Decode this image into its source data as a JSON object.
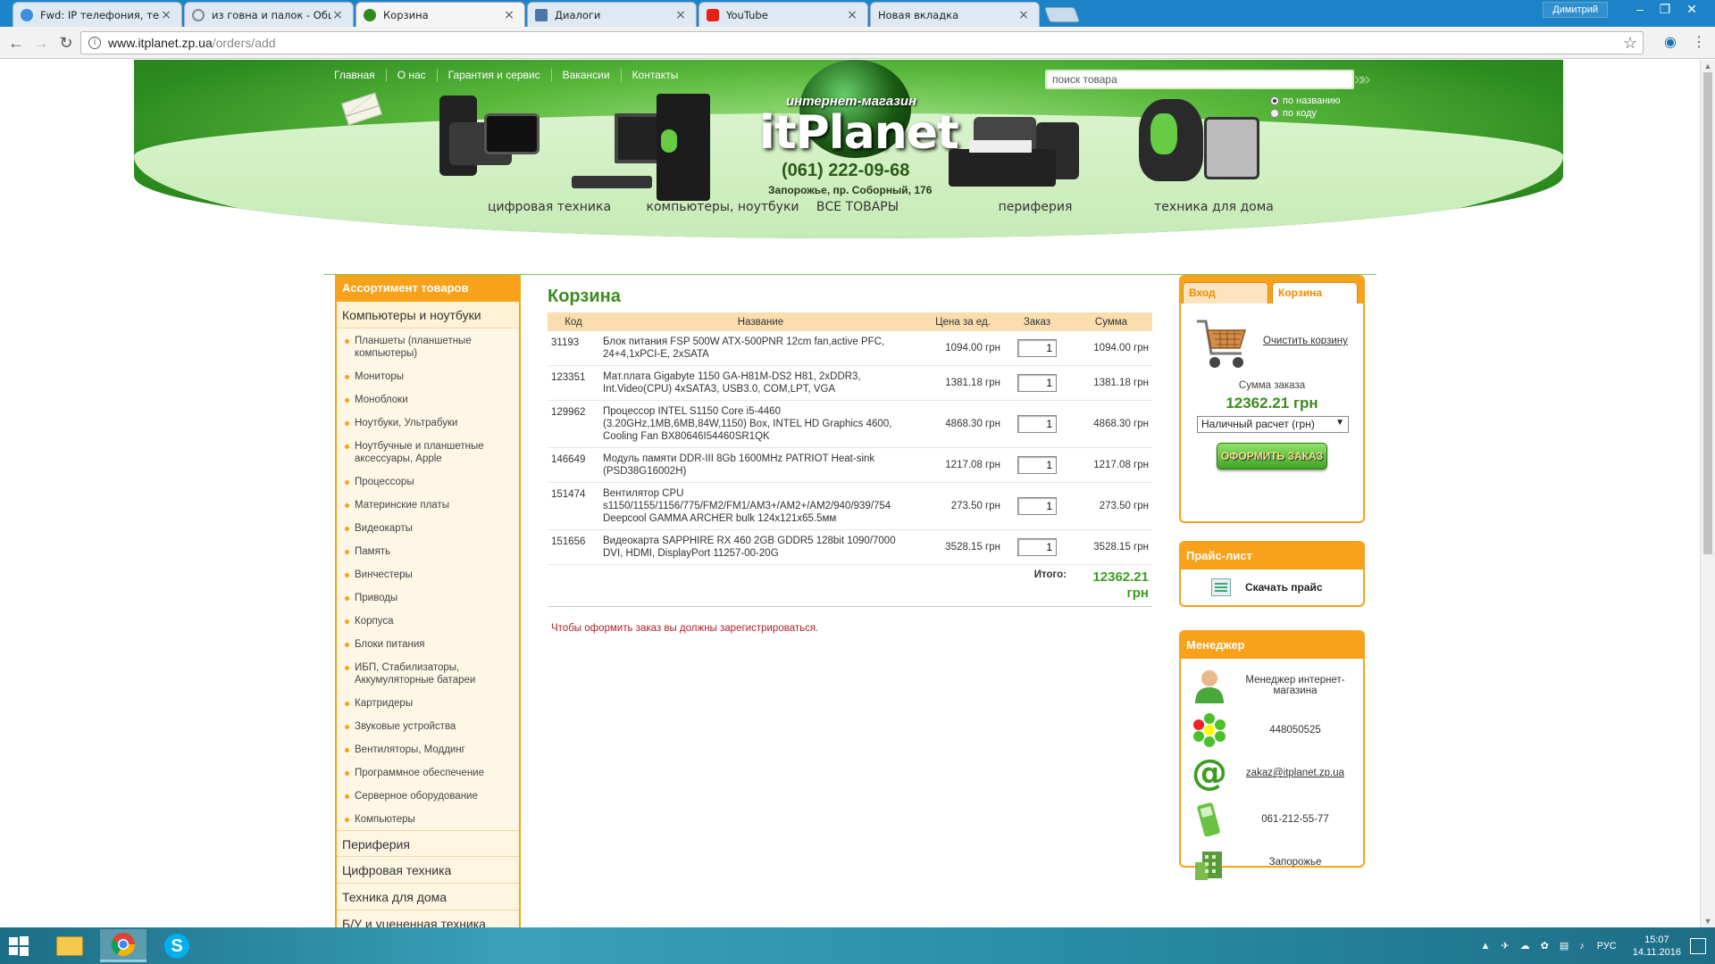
{
  "browser": {
    "tabs": [
      {
        "title": "Fwd: IP телефония, тенд",
        "color": "#3d8ee0"
      },
      {
        "title": "из говна и палок - Общ",
        "color": "#888888"
      },
      {
        "title": "Корзина",
        "color": "#2f8a1e"
      },
      {
        "title": "Диалоги",
        "color": "#4a76a8"
      },
      {
        "title": "YouTube",
        "color": "#e62117"
      },
      {
        "title": "Новая вкладка",
        "color": "#dfe9f3"
      }
    ],
    "user": "Димитрий",
    "url_domain": "www.itplanet.zp.ua",
    "url_path": "/orders/add"
  },
  "site": {
    "topnav": [
      "Главная",
      "О нас",
      "Гарантия и сервис",
      "Вакансии",
      "Контакты"
    ],
    "search_placeholder": "поиск товара",
    "search_mode": [
      "по названию",
      "по коду"
    ],
    "logo_sub": "интернет-магазин",
    "logo_main": "itPlanet",
    "phone": "(061) 222-09-68",
    "address": "Запорожье, пр. Соборный, 176",
    "categories": [
      "цифровая техника",
      "компьютеры, ноутбуки",
      "ВСЕ ТОВАРЫ",
      "периферия",
      "техника для дома"
    ]
  },
  "sidebar": {
    "title": "Ассортимент товаров",
    "open_category": "Компьютеры и ноутбуки",
    "items": [
      "Планшеты (планшетные компьютеры)",
      "Мониторы",
      "Моноблоки",
      "Ноутбуки, Ультрабуки",
      "Ноутбучные и планшетные аксессуары, Apple",
      "Процессоры",
      "Материнские платы",
      "Видеокарты",
      "Память",
      "Винчестеры",
      "Приводы",
      "Корпуса",
      "Блоки питания",
      "ИБП, Стабилизаторы, Аккумуляторные батареи",
      "Картридеры",
      "Звуковые устройства",
      "Вентиляторы, Моддинг",
      "Программное обеспечение",
      "Серверное оборудование",
      "Компьютеры"
    ],
    "other_categories": [
      "Периферия",
      "Цифровая техника",
      "Техника для дома",
      "Б/У и уцененная техника"
    ]
  },
  "cart": {
    "title": "Корзина",
    "columns": [
      "Код",
      "Название",
      "Цена за ед.",
      "Заказ",
      "Сумма"
    ],
    "rows": [
      {
        "code": "31193",
        "name": "Блок питания FSP 500W ATX-500PNR 12cm fan,active PFC, 24+4,1xPCI-E, 2xSATA",
        "price": "1094.00 грн",
        "qty": "1",
        "sum": "1094.00 грн"
      },
      {
        "code": "123351",
        "name": "Мат.плата Gigabyte 1150 GA-H81M-DS2 H81, 2xDDR3, Int.Video(CPU) 4xSATA3, USB3.0, COM,LPT, VGA",
        "price": "1381.18 грн",
        "qty": "1",
        "sum": "1381.18 грн"
      },
      {
        "code": "129962",
        "name": "Процессор INTEL S1150 Core i5-4460 (3.20GHz,1MB,6MB,84W,1150) Box, INTEL HD Graphics 4600, Cooling Fan BX80646I54460SR1QK",
        "price": "4868.30 грн",
        "qty": "1",
        "sum": "4868.30 грн"
      },
      {
        "code": "146649",
        "name": "Модуль памяти DDR-III 8Gb 1600MHz PATRIOT Heat-sink (PSD38G16002H)",
        "price": "1217.08 грн",
        "qty": "1",
        "sum": "1217.08 грн"
      },
      {
        "code": "151474",
        "name": "Вентилятор CPU s1150/1155/1156/775/FM2/FM1/AM3+/AM2+/AM2/940/939/754 Deepcool GAMMA ARCHER bulk 124x121x65.5мм",
        "price": "273.50 грн",
        "qty": "1",
        "sum": "273.50 грн"
      },
      {
        "code": "151656",
        "name": "Видеокарта SAPPHIRE RX 460 2GB GDDR5 128bit 1090/7000 DVI, HDMI, DisplayPort 11257-00-20G",
        "price": "3528.15 грн",
        "qty": "1",
        "sum": "3528.15 грн"
      }
    ],
    "total_label": "Итого:",
    "total_line1": "12362.21",
    "total_line2": "грн",
    "register_msg": "Чтобы оформить заказ вы должны зарегистрироваться."
  },
  "right": {
    "tab_login": "Вход",
    "tab_cart": "Корзина",
    "clear_cart": "Очистить корзину",
    "sum_label": "Сумма заказа",
    "sum_value": "12362.21 грн",
    "payment": "Наличный расчет (грн)",
    "order_button": "ОФОРМИТЬ ЗАКАЗ",
    "price_title": "Прайс-лист",
    "price_download": "Скачать прайс",
    "manager_title": "Менеджер",
    "manager_name": "Менеджер интернет-магазина",
    "icq": "448050525",
    "email": "zakaz@itplanet.zp.ua",
    "phone": "061-212-55-77",
    "city": "Запорожье"
  },
  "taskbar": {
    "lang": "РУС",
    "time": "15:07",
    "date": "14.11.2016"
  }
}
